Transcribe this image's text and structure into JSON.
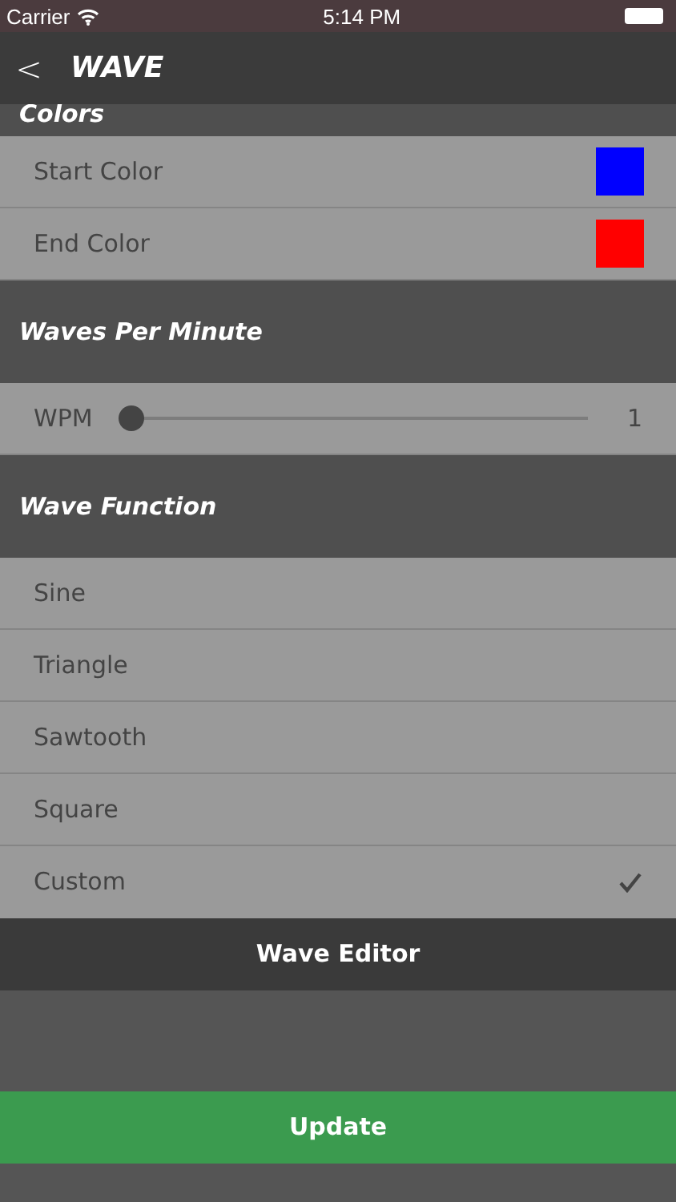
{
  "status_bar": {
    "carrier": "Carrier",
    "time": "5:14 PM"
  },
  "nav": {
    "back": "<",
    "title": "WAVE"
  },
  "sections": [
    {
      "header": "Colors",
      "rows": [
        {
          "kind": "color",
          "label": "Start Color",
          "color": "#0000ff"
        },
        {
          "kind": "color",
          "label": "End Color",
          "color": "#ff0000"
        }
      ]
    },
    {
      "header": "Waves Per Minute",
      "rows": [
        {
          "kind": "slider",
          "label": "WPM",
          "level": 0,
          "reading": "1"
        }
      ]
    },
    {
      "header": "Wave Function",
      "rows": [
        {
          "kind": "choice",
          "label": "Sine",
          "selected": false
        },
        {
          "kind": "choice",
          "label": "Triangle",
          "selected": false
        },
        {
          "kind": "choice",
          "label": "Sawtooth",
          "selected": false
        },
        {
          "kind": "choice",
          "label": "Square",
          "selected": false
        },
        {
          "kind": "choice",
          "label": "Custom",
          "selected": true
        }
      ]
    }
  ],
  "editor_button": "Wave Editor",
  "update_button": "Update"
}
